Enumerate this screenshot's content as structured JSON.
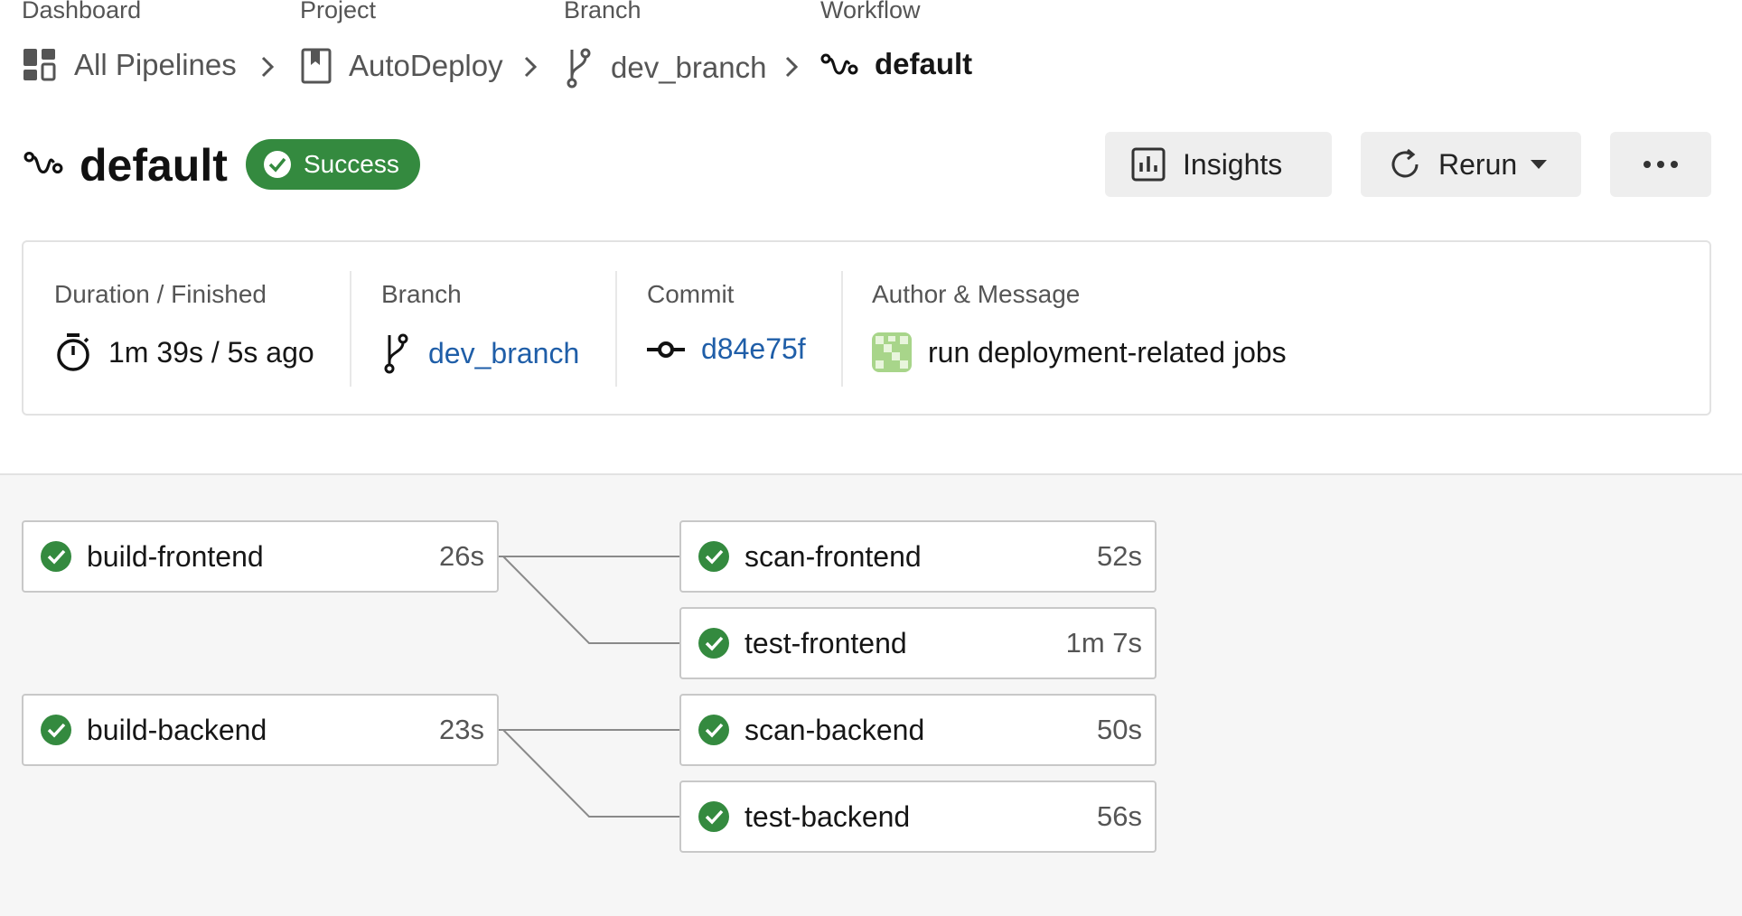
{
  "breadcrumb": [
    {
      "category": "Dashboard",
      "label": "All Pipelines",
      "icon": "dashboard-icon"
    },
    {
      "category": "Project",
      "label": "AutoDeploy",
      "icon": "project-bookmark-icon"
    },
    {
      "category": "Branch",
      "label": "dev_branch",
      "icon": "branch-icon"
    },
    {
      "category": "Workflow",
      "label": "default",
      "icon": "workflow-icon"
    }
  ],
  "header": {
    "title": "default",
    "status": "Success",
    "buttons": {
      "insights": "Insights",
      "rerun": "Rerun",
      "more": "more-icon"
    }
  },
  "summary": {
    "duration": {
      "label": "Duration / Finished",
      "value": "1m 39s / 5s ago"
    },
    "branch": {
      "label": "Branch",
      "value": "dev_branch"
    },
    "commit": {
      "label": "Commit",
      "value": "d84e75f"
    },
    "author": {
      "label": "Author & Message",
      "value": "run deployment-related jobs"
    }
  },
  "jobs": [
    {
      "name": "build-frontend",
      "duration": "26s",
      "status": "success"
    },
    {
      "name": "scan-frontend",
      "duration": "52s",
      "status": "success"
    },
    {
      "name": "test-frontend",
      "duration": "1m 7s",
      "status": "success"
    },
    {
      "name": "build-backend",
      "duration": "23s",
      "status": "success"
    },
    {
      "name": "scan-backend",
      "duration": "50s",
      "status": "success"
    },
    {
      "name": "test-backend",
      "duration": "56s",
      "status": "success"
    }
  ],
  "colors": {
    "success": "#348a3f",
    "link": "#1f5ea8",
    "button_bg": "#eeeeee",
    "graph_bg": "#f6f6f6"
  }
}
